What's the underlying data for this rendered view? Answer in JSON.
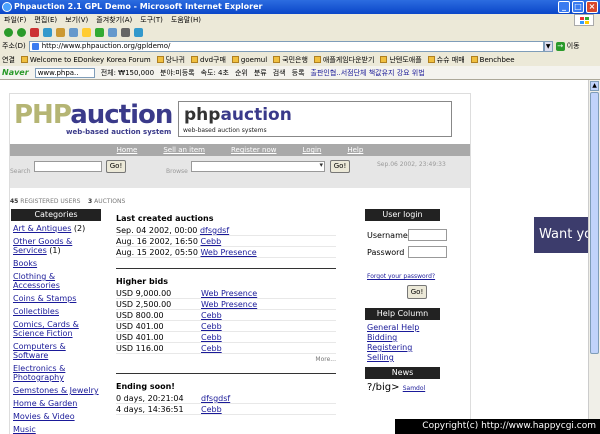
{
  "window": {
    "title": "Phpauction 2.1 GPL Demo - Microsoft Internet Explorer"
  },
  "menu": [
    "파일(F)",
    "편집(E)",
    "보기(V)",
    "즐겨찾기(A)",
    "도구(T)",
    "도움말(H)"
  ],
  "address": {
    "label": "주소(D)",
    "url": "http://www.phpauction.org/gpldemo/",
    "go_label": "이동"
  },
  "links": {
    "label": "연결",
    "items": [
      "Welcome to EDonkey Korea Forum",
      "당나귀",
      "dvd구매",
      "goemul",
      "국민은행",
      "애플게임다운받기",
      "난텐도애플",
      "슈슈 매매",
      "Benchbee"
    ]
  },
  "naver": {
    "logo": "Naver",
    "search_value": "www.phpa..",
    "status1": "전체: ₩150,000",
    "status2": "분야:미등록",
    "status3": "속도: 4초",
    "btn1": "순위",
    "btn2": "분류",
    "btn3": "검색",
    "btn4": "등록",
    "hotnews": "출판인협..서점단체 책값유지 강요 위법"
  },
  "site": {
    "logo_php": "PHP",
    "logo_auction": "auction",
    "logo_sub": "web-based auction system",
    "banner_php": "php",
    "banner_auction": "auction",
    "banner_sub": "web-based auction systems",
    "banner_text": "Want your own auction site?",
    "nav": [
      "Home",
      "Sell an item",
      "Register now",
      "Login",
      "Help"
    ],
    "search_label": "Search",
    "search_btn": "Go!",
    "browse_label": "Browse",
    "browse_btn": "Go!",
    "datetime": "Sep.06 2002, 23:49:33",
    "stats_users_count": "45",
    "stats_users_label": "REGISTERED USERS",
    "stats_auctions_count": "3",
    "stats_auctions_label": "AUCTIONS"
  },
  "categories": {
    "title": "Categories",
    "items": [
      {
        "label": "Art & Antiques",
        "count": " (2)"
      },
      {
        "label": "Other Goods & Services",
        "count": " (1)"
      },
      {
        "label": "Books",
        "count": ""
      },
      {
        "label": "Clothing & Accessories",
        "count": ""
      },
      {
        "label": "Coins & Stamps",
        "count": ""
      },
      {
        "label": "Collectibles",
        "count": ""
      },
      {
        "label": "Comics, Cards & Science Fiction",
        "count": ""
      },
      {
        "label": "Computers & Software",
        "count": ""
      },
      {
        "label": "Electronics & Photography",
        "count": ""
      },
      {
        "label": "Gemstones & Jewelry",
        "count": ""
      },
      {
        "label": "Home & Garden",
        "count": ""
      },
      {
        "label": "Movies & Video",
        "count": ""
      },
      {
        "label": "Music",
        "count": ""
      }
    ]
  },
  "last_created": {
    "title": "Last created auctions",
    "rows": [
      {
        "date": "Sep. 04 2002, 00:00",
        "item": "dfsgdsf"
      },
      {
        "date": "Aug. 16 2002, 16:50",
        "item": "Cebb"
      },
      {
        "date": "Aug. 15 2002, 05:50",
        "item": "Web Presence"
      }
    ]
  },
  "higher_bids": {
    "title": "Higher bids",
    "rows": [
      {
        "price": "USD 9,000.00",
        "item": "Web Presence"
      },
      {
        "price": "USD 2,500.00",
        "item": "Web Presence"
      },
      {
        "price": "USD 800.00",
        "item": "Cebb"
      },
      {
        "price": "USD 401.00",
        "item": "Cebb"
      },
      {
        "price": "USD 401.00",
        "item": "Cebb"
      },
      {
        "price": "USD 116.00",
        "item": "Cebb"
      }
    ],
    "more": "More..."
  },
  "ending_soon": {
    "title": "Ending soon!",
    "rows": [
      {
        "time": "0 days, 20:21:04",
        "item": "dfsgdsf"
      },
      {
        "time": "4 days, 14:36:51",
        "item": "Cebb"
      }
    ]
  },
  "user_login": {
    "title": "User login",
    "username_label": "Username",
    "password_label": "Password",
    "forgot": "Forgot your password?",
    "go_btn": "Go!"
  },
  "help_column": {
    "title": "Help Column",
    "items": [
      "General Help",
      "Bidding",
      "Registering",
      "Selling"
    ]
  },
  "news": {
    "title": "News",
    "prefix": "?/big>",
    "item": "Samdol"
  },
  "copyright": "Copyright(c) http://www.happycgi.com"
}
